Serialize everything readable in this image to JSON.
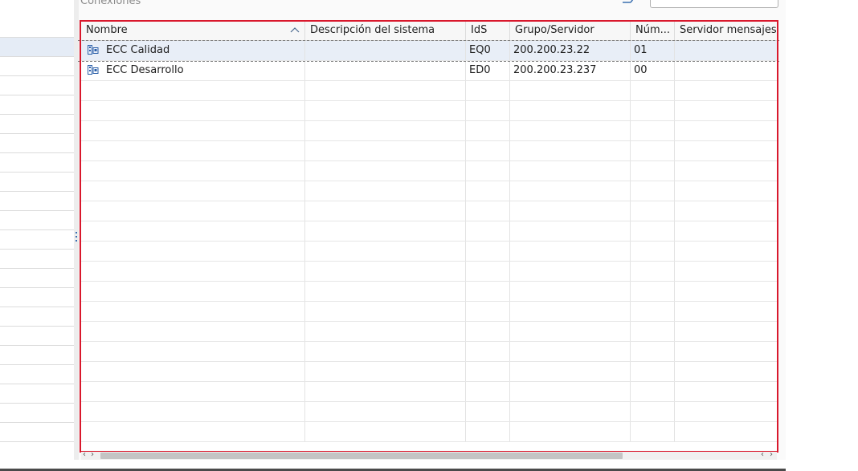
{
  "panel": {
    "title": "Conexiones"
  },
  "filter": {
    "placeholder": ""
  },
  "grid": {
    "columns": [
      {
        "label": "Nombre",
        "sort": "ascending"
      },
      {
        "label": "Descripción del sistema"
      },
      {
        "label": "IdS"
      },
      {
        "label": "Grupo/Servidor"
      },
      {
        "label": "Núm..."
      },
      {
        "label": "Servidor mensajes"
      }
    ],
    "rows": [
      {
        "name": "ECC Calidad",
        "description": "",
        "sid": "EQ0",
        "server": "200.200.23.22",
        "instance": "01",
        "message_server": "",
        "selected": true
      },
      {
        "name": "ECC Desarrollo",
        "description": "",
        "sid": "ED0",
        "server": "200.200.23.237",
        "instance": "00",
        "message_server": "",
        "selected": false
      }
    ]
  },
  "scroll": {
    "left_arrow": "‹",
    "right_arrow": "›"
  },
  "colors": {
    "accent": "#d9182c",
    "selection": "#e8eef7",
    "icon_blue": "#2a5fa8"
  }
}
